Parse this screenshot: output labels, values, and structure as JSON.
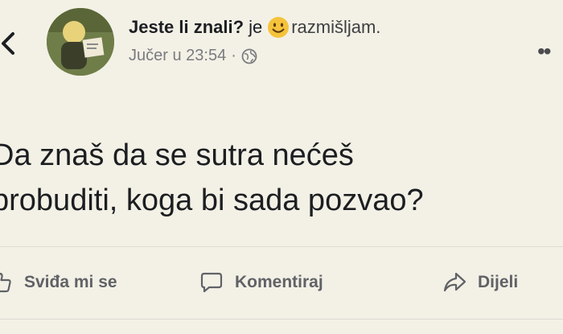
{
  "post": {
    "author": "Jeste li znali?",
    "connector": "je",
    "activity": "razmišljam.",
    "timestamp": "Jučer u 23:54",
    "separator": "·",
    "text_lines": [
      "Da znaš da se sutra nećeš",
      "probuditi, koga bi sada pozvao?"
    ]
  },
  "actions": {
    "like": "Sviđa mi se",
    "comment": "Komentiraj",
    "share": "Dijeli"
  },
  "icons": {
    "back": "chevron-left-icon",
    "emoji": "smiley-icon",
    "privacy": "globe-icon",
    "more": "more-dots-icon",
    "like": "thumbs-up-icon",
    "comment": "comment-icon",
    "share": "share-arrow-icon"
  },
  "colors": {
    "background": "#f3f1e6",
    "text": "#1c1e21",
    "muted": "#606266",
    "emoji": "#f5c33b"
  }
}
